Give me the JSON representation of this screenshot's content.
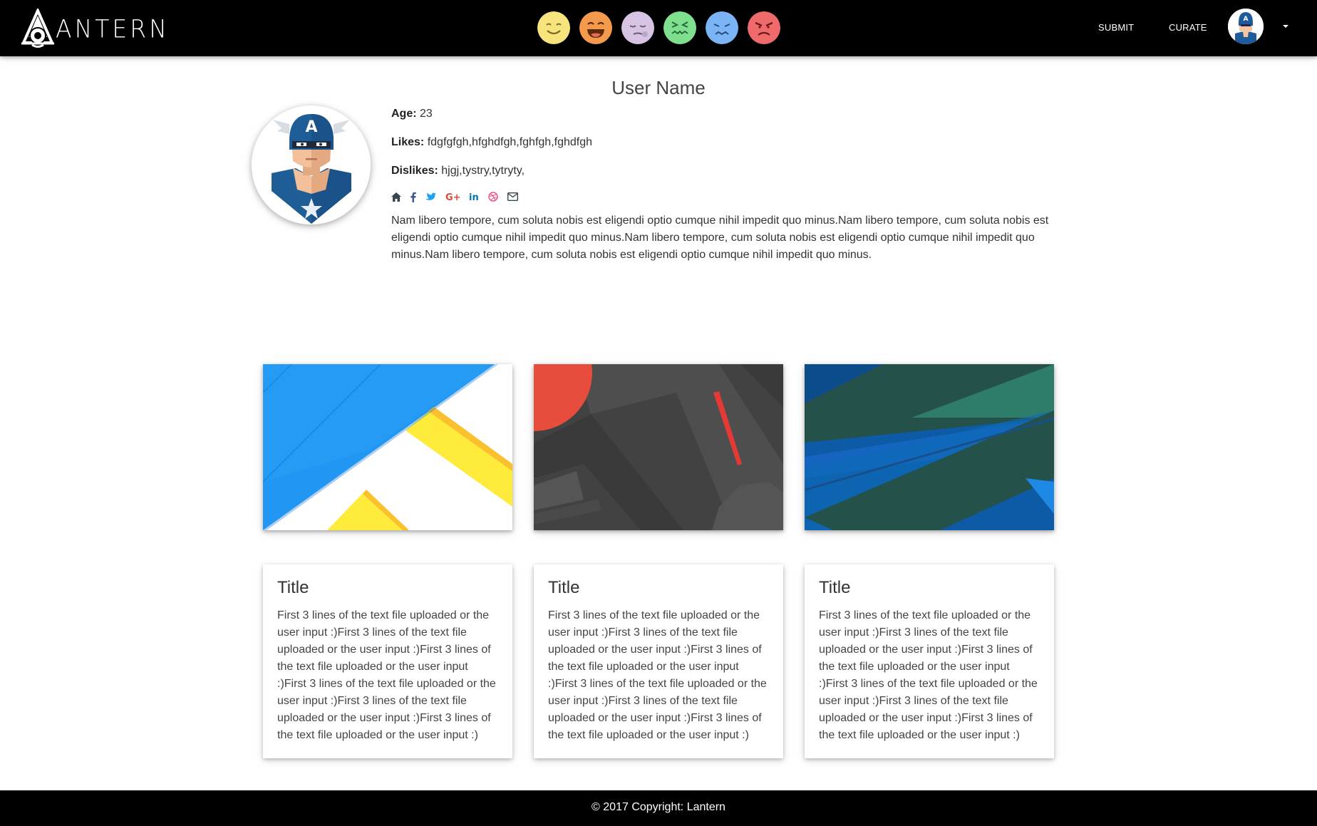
{
  "brand": {
    "name": "ANTERN"
  },
  "nav": {
    "moods": [
      {
        "name": "happy",
        "color": "#f7e47c"
      },
      {
        "name": "laughing",
        "color": "#f49a4d"
      },
      {
        "name": "sleepy",
        "color": "#d7c4e4"
      },
      {
        "name": "sick",
        "color": "#7ee08e"
      },
      {
        "name": "sad",
        "color": "#7ab4f5"
      },
      {
        "name": "angry",
        "color": "#ef6b6b"
      }
    ],
    "submit_label": "SUBMIT",
    "curate_label": "CURATE"
  },
  "profile": {
    "name": "User Name",
    "age_label": "Age:",
    "age": "23",
    "likes_label": "Likes:",
    "likes": "fdgfgfgh,hfghdfgh,fghfgh,fghdfgh",
    "dislikes_label": "Dislikes:",
    "dislikes": "hjgj,tystry,tytryty,",
    "social_icons": [
      "home-icon",
      "facebook-icon",
      "twitter-icon",
      "google-plus-icon",
      "linkedin-icon",
      "dribbble-icon",
      "envelope-icon"
    ],
    "bio": "Nam libero tempore, cum soluta nobis est eligendi optio cumque nihil impedit quo minus.Nam libero tempore, cum soluta nobis est eligendi optio cumque nihil impedit quo minus.Nam libero tempore, cum soluta nobis est eligendi optio cumque nihil impedit quo minus.Nam libero tempore, cum soluta nobis est eligendi optio cumque nihil impedit quo minus."
  },
  "cards": [
    {
      "title": "Title",
      "text": "First 3 lines of the text file uploaded or the user input :)First 3 lines of the text file uploaded or the user input :)First 3 lines of the text file uploaded or the user input :)First 3 lines of the text file uploaded or the user input :)First 3 lines of the text file uploaded or the user input :)First 3 lines of the text file uploaded or the user input :)"
    },
    {
      "title": "Title",
      "text": "First 3 lines of the text file uploaded or the user input :)First 3 lines of the text file uploaded or the user input :)First 3 lines of the text file uploaded or the user input :)First 3 lines of the text file uploaded or the user input :)First 3 lines of the text file uploaded or the user input :)First 3 lines of the text file uploaded or the user input :)"
    },
    {
      "title": "Title",
      "text": "First 3 lines of the text file uploaded or the user input :)First 3 lines of the text file uploaded or the user input :)First 3 lines of the text file uploaded or the user input :)First 3 lines of the text file uploaded or the user input :)First 3 lines of the text file uploaded or the user input :)First 3 lines of the text file uploaded or the user input :)"
    }
  ],
  "footer": {
    "text": "© 2017 Copyright: Lantern"
  },
  "colors": {
    "navbar": "#000000",
    "footer": "#000000",
    "blue": "#2196f3",
    "yellow": "#ffeb3b",
    "dark_gray": "#424242",
    "red": "#e74c3c",
    "teal": "#2e7d6b"
  }
}
